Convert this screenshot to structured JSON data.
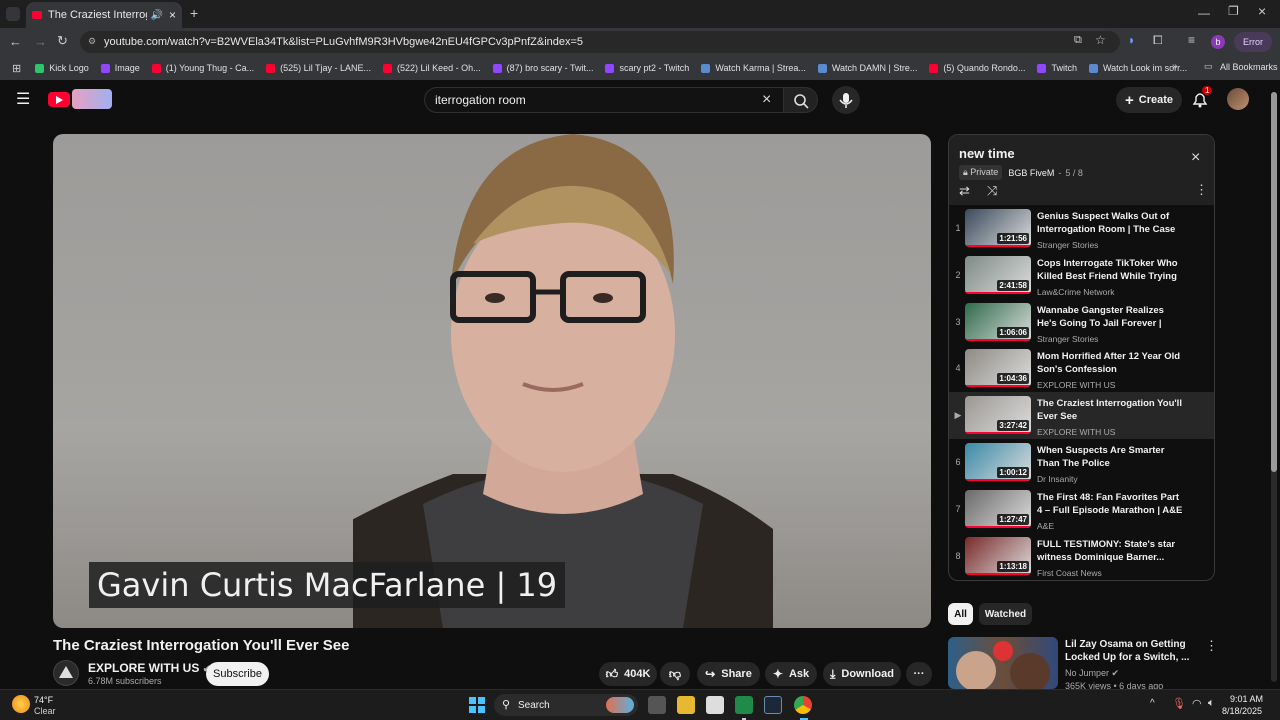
{
  "browser": {
    "tab_title": "The Craziest Interrogation Y",
    "url": "youtube.com/watch?v=B2WVEla34Tk&list=PLuGvhfM9R3HVbgwe42nEU4fGPCv3pPnfZ&index=5",
    "error_label": "Error",
    "profile_initial": "b",
    "bookmarks": [
      "Kick Logo",
      "Image",
      "(1) Young Thug - Ca...",
      "(525) Lil Tjay - LANE...",
      "(522) Lil Keed - Oh...",
      "(87) bro scary - Twit...",
      "scary pt2 - Twitch",
      "Watch Karma | Strea...",
      "Watch DAMN | Stre...",
      "(5) Quando Rondo...",
      "Twitch",
      "Watch Look im sorr..."
    ],
    "all_bookmarks": "All Bookmarks"
  },
  "yt": {
    "search_value": "iterrogation room",
    "create_label": "Create",
    "notif_count": "1"
  },
  "video": {
    "overlay_caption": "Gavin Curtis MacFarlane | 19",
    "title": "The Craziest Interrogation You'll Ever See",
    "channel": "EXPLORE WITH US",
    "subscribers": "6.78M subscribers",
    "subscribe_label": "Subscribe",
    "likes": "404K",
    "share_label": "Share",
    "ask_label": "Ask",
    "download_label": "Download"
  },
  "playlist": {
    "title": "new time",
    "privacy": "Private",
    "owner": "BGB FiveM",
    "position": "5 / 8",
    "items": [
      {
        "idx": "1",
        "title": "Genius Suspect Walks Out of Interrogation Room | The Case o...",
        "channel": "Stranger Stories",
        "duration": "1:21:56",
        "thumb": "#3a4a5c"
      },
      {
        "idx": "2",
        "title": "Cops Interrogate TikToker Who Killed Best Friend While Trying t...",
        "channel": "Law&Crime Network",
        "duration": "2:41:58",
        "thumb": "#7d8a86"
      },
      {
        "idx": "3",
        "title": "Wannabe Gangster Realizes He's Going To Jail Forever | The...",
        "channel": "Stranger Stories",
        "duration": "1:06:06",
        "thumb": "#2e6b4a"
      },
      {
        "idx": "4",
        "title": "Mom Horrified After 12 Year Old Son's Confession",
        "channel": "EXPLORE WITH US",
        "duration": "1:04:36",
        "thumb": "#8e8a84"
      },
      {
        "idx": "▶",
        "title": "The Craziest Interrogation You'll Ever See",
        "channel": "EXPLORE WITH US",
        "duration": "3:27:42",
        "thumb": "#9a9692"
      },
      {
        "idx": "6",
        "title": "When Suspects Are Smarter Than The Police",
        "channel": "Dr Insanity",
        "duration": "1:00:12",
        "thumb": "#3a8aa8"
      },
      {
        "idx": "7",
        "title": "The First 48: Fan Favorites Part 4 – Full Episode Marathon | A&E",
        "channel": "A&E",
        "duration": "1:27:47",
        "thumb": "#6a6a6a"
      },
      {
        "idx": "8",
        "title": "FULL TESTIMONY: State's star witness Dominique Barner...",
        "channel": "First Coast News",
        "duration": "1:13:18",
        "thumb": "#7a2a2a"
      }
    ]
  },
  "chips": [
    "All",
    "Watched"
  ],
  "recommendation": {
    "title": "Lil Zay Osama on Getting Locked Up for a Switch, ...",
    "channel": "No Jumper",
    "views": "365K views • 6 days ago"
  },
  "taskbar": {
    "temp": "74°F",
    "weather": "Clear",
    "search_label": "Search",
    "time": "9:01 AM",
    "date": "8/18/2025"
  },
  "colors": {
    "accent": "#ff0033",
    "bg": "#0f0f0f"
  }
}
